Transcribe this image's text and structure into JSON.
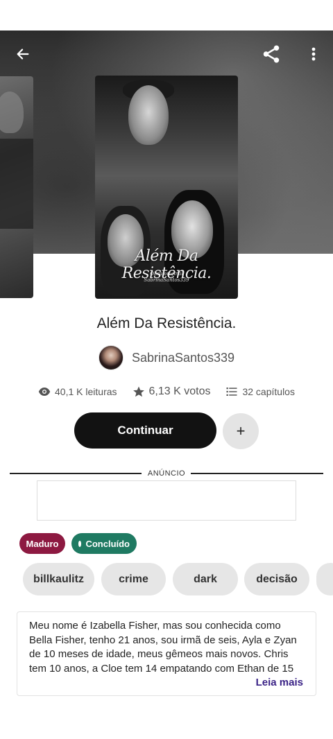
{
  "story": {
    "title": "Além Da Resistência.",
    "cover_title": "Além Da Resistência.",
    "cover_subtitle_line1": "Obra original",
    "cover_subtitle_line2": "SabrinaSantos339"
  },
  "author": {
    "name": "SabrinaSantos339"
  },
  "stats": {
    "reads": "40,1 K leituras",
    "votes": "6,13 K votos",
    "chapters": "32 capítulos"
  },
  "actions": {
    "continue_label": "Continuar",
    "add_label": "+"
  },
  "ad": {
    "label": "ANÚNCIO"
  },
  "badges": {
    "mature": "Maduro",
    "completed": "Concluído"
  },
  "tags": [
    "billkaulitz",
    "crime",
    "dark",
    "decisão"
  ],
  "description": {
    "text": "Meu nome é Izabella Fisher, mas sou conhecida como Bella Fisher, tenho 21 anos, sou irmã de seis, Ayla e Zyan de 10 meses de idade, meus gêmeos mais novos. Chris tem 10 anos, a Cloe tem 14 empatando com Ethan de 15",
    "read_more": "Leia mais"
  },
  "icons": {
    "back": "arrow-left-icon",
    "share": "share-icon",
    "more": "more-vertical-icon",
    "reads": "eye-icon",
    "votes": "star-icon",
    "chapters": "list-icon"
  },
  "colors": {
    "mature_badge": "#8d1941",
    "completed_badge": "#1f7a62",
    "read_more": "#3a2286",
    "continue_button": "#121212"
  }
}
